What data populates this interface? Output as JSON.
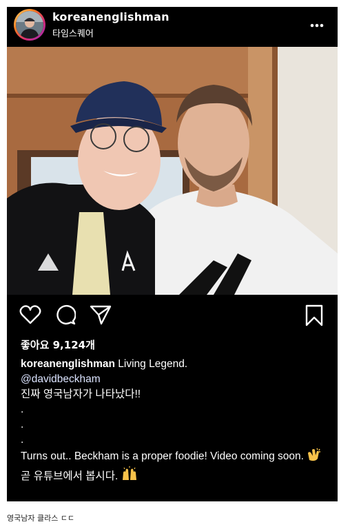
{
  "post": {
    "username": "koreanenglishman",
    "location": "타임스퀘어",
    "likes_label": "좋아요 9,124개",
    "caption": {
      "username": "koreanenglishman",
      "text": "Living Legend.",
      "mention": "@davidbeckham",
      "line_korean": "진짜 영국남자가 나타났다!!",
      "dots": [
        ".",
        ".",
        "."
      ],
      "line_english": "Turns out.. Beckham is a proper foodie! Video coming soon.",
      "line_korean_2": "곧 유튜브에서 봅시다."
    }
  },
  "icons": [
    "more-options-icon",
    "heart-icon",
    "comment-icon",
    "share-icon",
    "bookmark-icon",
    "clapping-hands-emoji",
    "raised-hands-emoji"
  ],
  "footnote": "영국남자 클라스 ㄷㄷ",
  "colors": {
    "background": "#000000",
    "text": "#ffffff",
    "mention": "#dbe3ff"
  }
}
